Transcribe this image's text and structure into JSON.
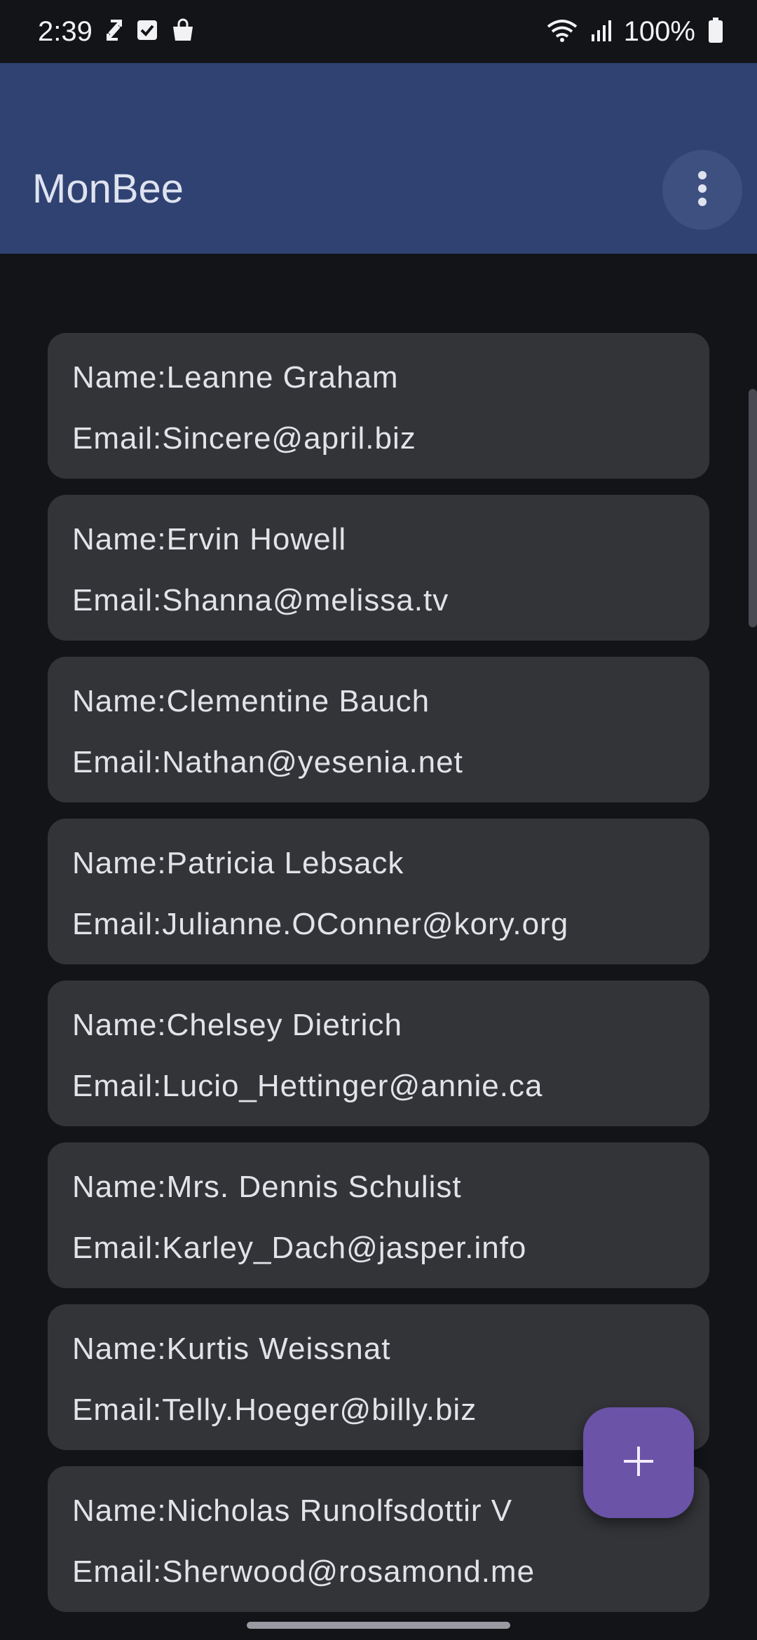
{
  "status_bar": {
    "time": "2:39",
    "battery": "100%",
    "icons": [
      "sync-icon",
      "checkbox-icon",
      "shopping-bag-icon",
      "wifi-icon",
      "signal-icon",
      "battery-icon"
    ]
  },
  "app_bar": {
    "title": "MonBee",
    "overflow_icon": "more-vert-icon"
  },
  "users": [
    {
      "name": "Name:Leanne Graham",
      "email": "Email:Sincere@april.biz"
    },
    {
      "name": "Name:Ervin Howell",
      "email": "Email:Shanna@melissa.tv"
    },
    {
      "name": "Name:Clementine Bauch",
      "email": "Email:Nathan@yesenia.net"
    },
    {
      "name": "Name:Patricia Lebsack",
      "email": "Email:Julianne.OConner@kory.org"
    },
    {
      "name": "Name:Chelsey Dietrich",
      "email": "Email:Lucio_Hettinger@annie.ca"
    },
    {
      "name": "Name:Mrs. Dennis Schulist",
      "email": "Email:Karley_Dach@jasper.info"
    },
    {
      "name": "Name:Kurtis Weissnat",
      "email": "Email:Telly.Hoeger@billy.biz"
    },
    {
      "name": "Name:Nicholas Runolfsdottir V",
      "email": "Email:Sherwood@rosamond.me"
    }
  ],
  "fab": {
    "icon": "plus-icon"
  },
  "colors": {
    "background": "#131418",
    "app_bar": "#2f4272",
    "card": "#333438",
    "fab": "#6b53a8"
  }
}
